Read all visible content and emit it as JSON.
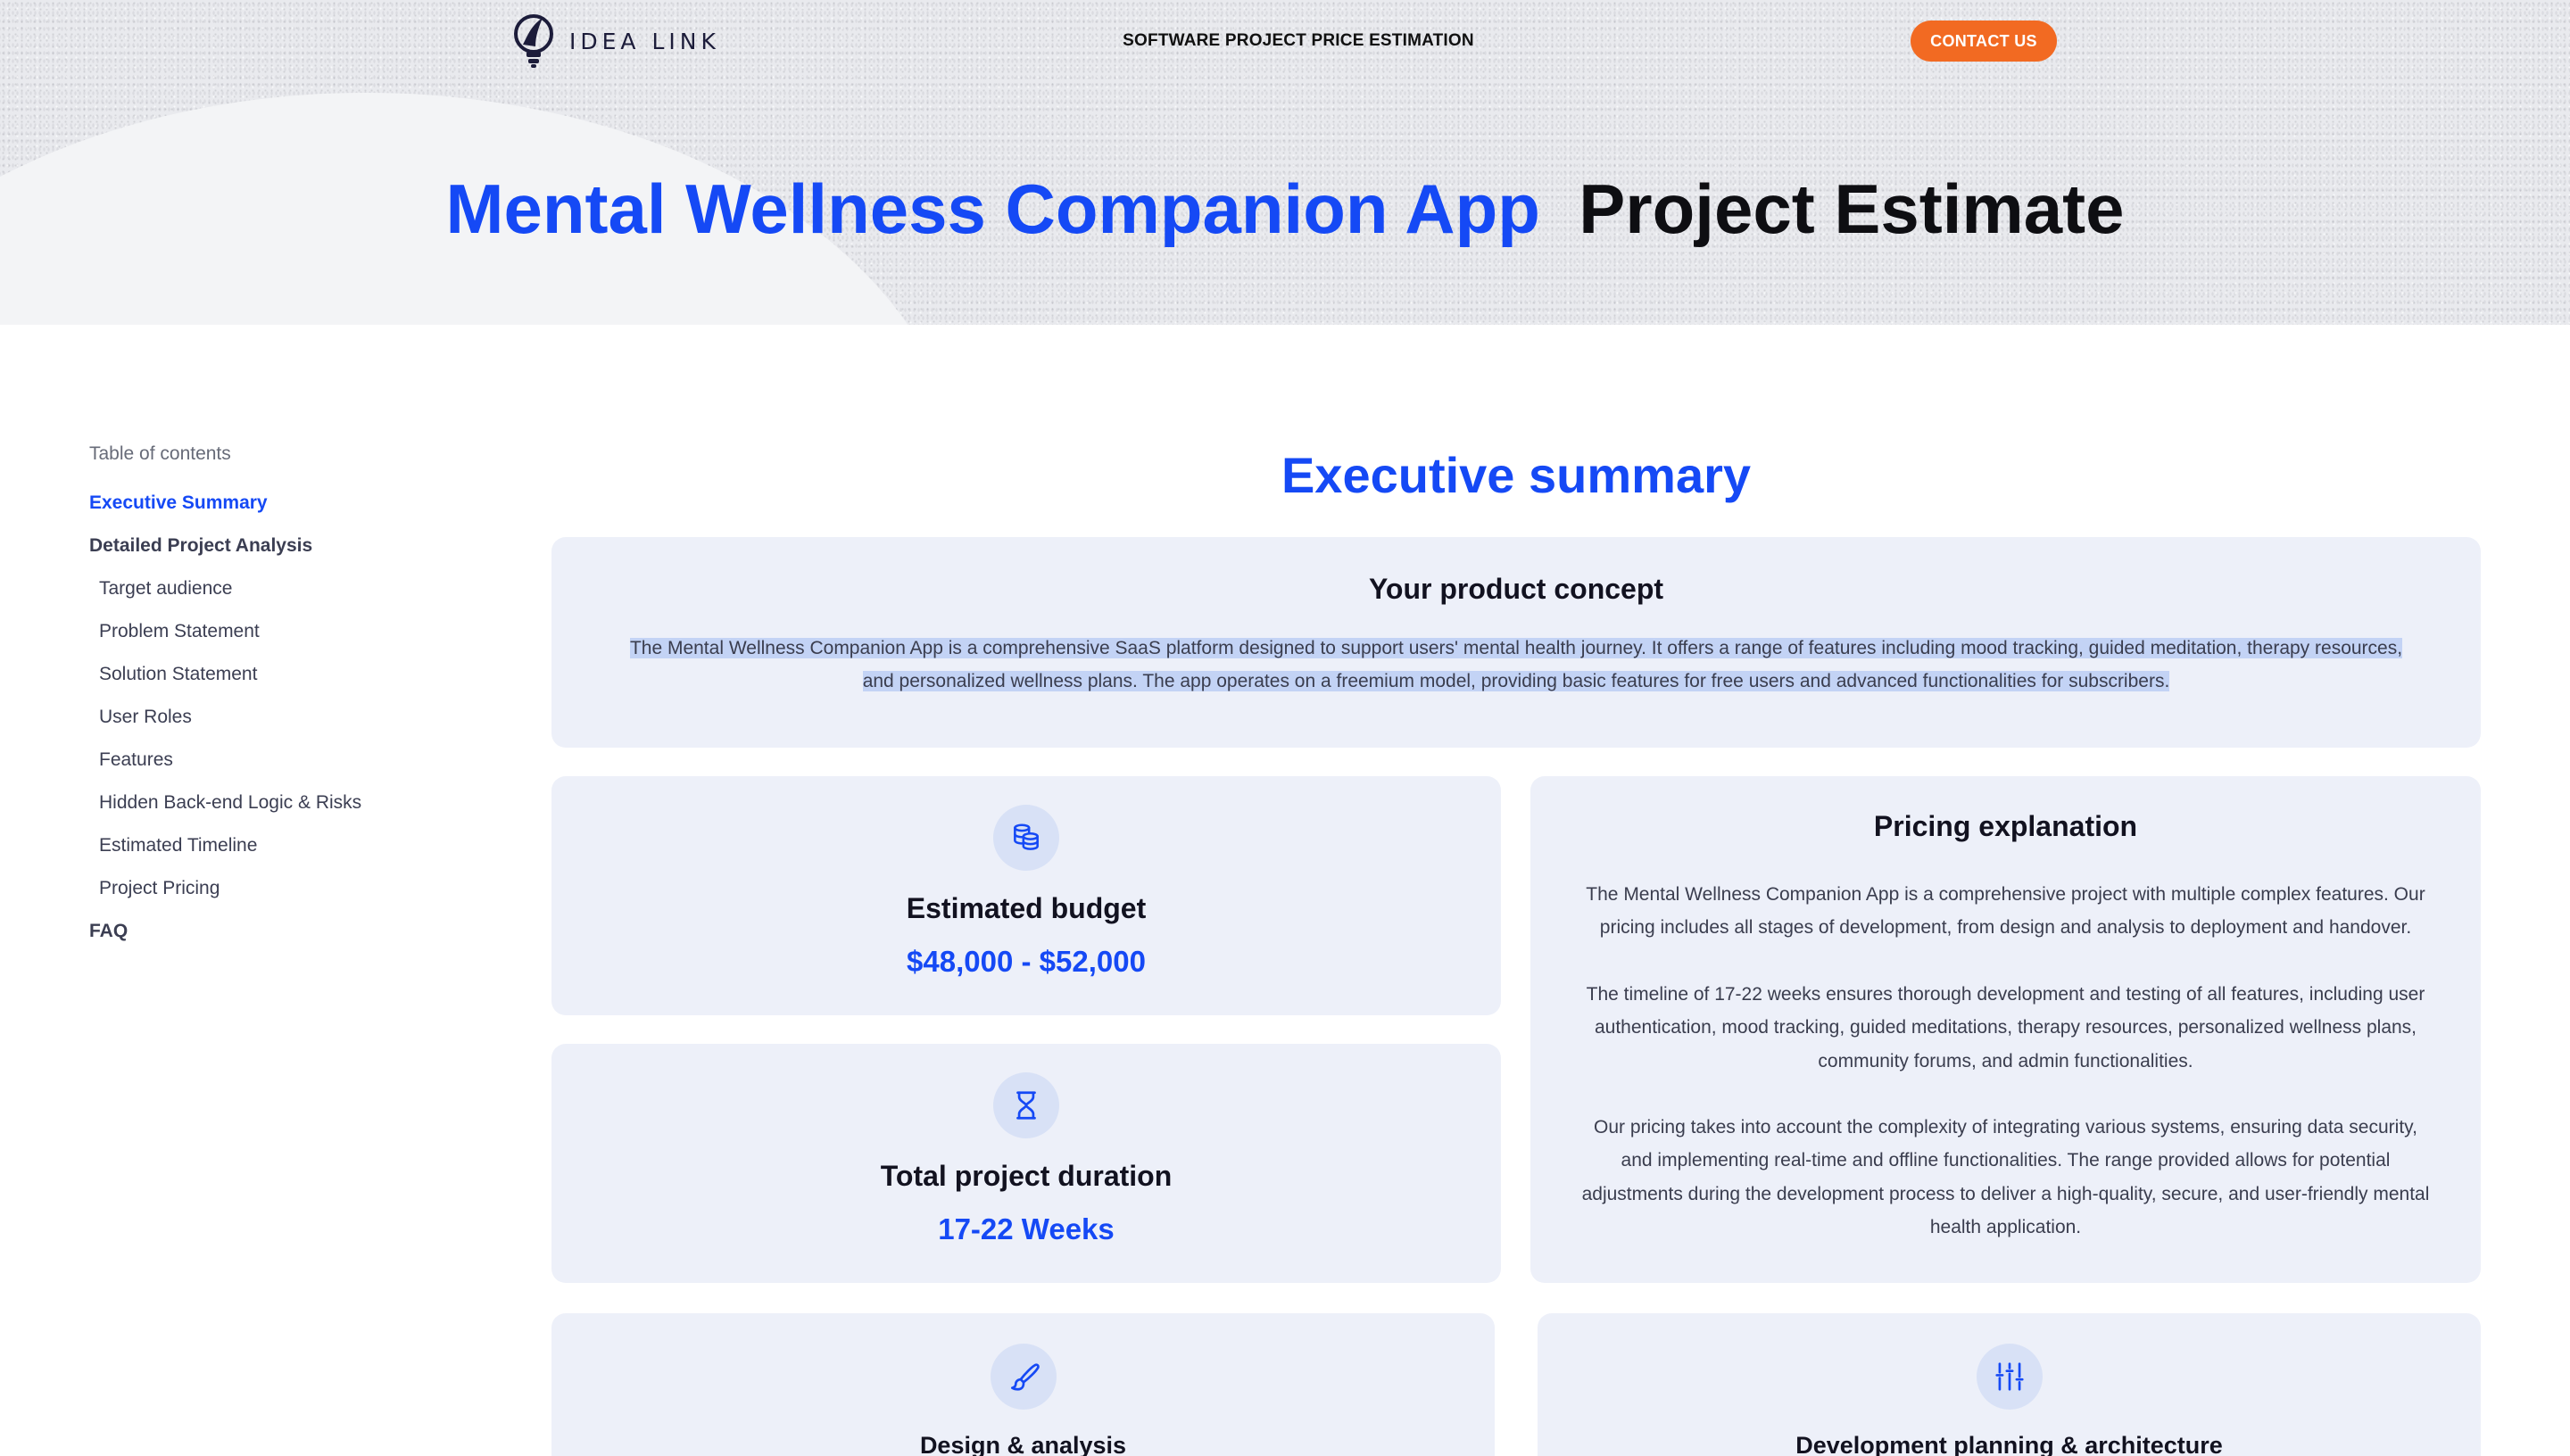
{
  "header": {
    "logo_text": "IDEA LINK",
    "nav_title": "SOFTWARE PROJECT PRICE ESTIMATION",
    "contact_label": "CONTACT US",
    "title_accent": "Mental Wellness Companion App",
    "title_rest": "Project Estimate"
  },
  "toc": {
    "heading": "Table of contents",
    "items": [
      {
        "label": "Executive Summary"
      },
      {
        "label": "Detailed Project Analysis"
      },
      {
        "label": "Target audience"
      },
      {
        "label": "Problem Statement"
      },
      {
        "label": "Solution Statement"
      },
      {
        "label": "User Roles"
      },
      {
        "label": "Features"
      },
      {
        "label": "Hidden Back-end Logic & Risks"
      },
      {
        "label": "Estimated Timeline"
      },
      {
        "label": "Project Pricing"
      },
      {
        "label": "FAQ"
      }
    ]
  },
  "main": {
    "section_title": "Executive summary",
    "concept": {
      "heading": "Your product concept",
      "text": "The Mental Wellness Companion App is a comprehensive SaaS platform designed to support users' mental health journey. It offers a range of features including mood tracking, guided meditation, therapy resources, and personalized wellness plans. The app operates on a freemium model, providing basic features for free users and advanced functionalities for subscribers."
    },
    "budget": {
      "icon": "coins-icon",
      "heading": "Estimated budget",
      "value": "$48,000 - $52,000"
    },
    "duration": {
      "icon": "hourglass-icon",
      "heading": "Total project duration",
      "value": "17-22 Weeks"
    },
    "pricing": {
      "heading": "Pricing explanation",
      "paragraphs": [
        "The Mental Wellness Companion App is a comprehensive project with multiple complex features. Our pricing includes all stages of development, from design and analysis to deployment and handover.",
        "The timeline of 17-22 weeks ensures thorough development and testing of all features, including user authentication, mood tracking, guided meditations, therapy resources, personalized wellness plans, community forums, and admin functionalities.",
        "Our pricing takes into account the complexity of integrating various systems, ensuring data security, and implementing real-time and offline functionalities. The range provided allows for potential adjustments during the development process to deliver a high-quality, secure, and user-friendly mental health application."
      ]
    },
    "design": {
      "icon": "brush-icon",
      "heading": "Design & analysis"
    },
    "devplan": {
      "icon": "sliders-icon",
      "heading": "Development planning & architecture"
    }
  },
  "colors": {
    "accent": "#1549f5",
    "contact_button": "#f26a22",
    "card_bg": "#edf0f9",
    "selection": "#c3d3f5"
  }
}
